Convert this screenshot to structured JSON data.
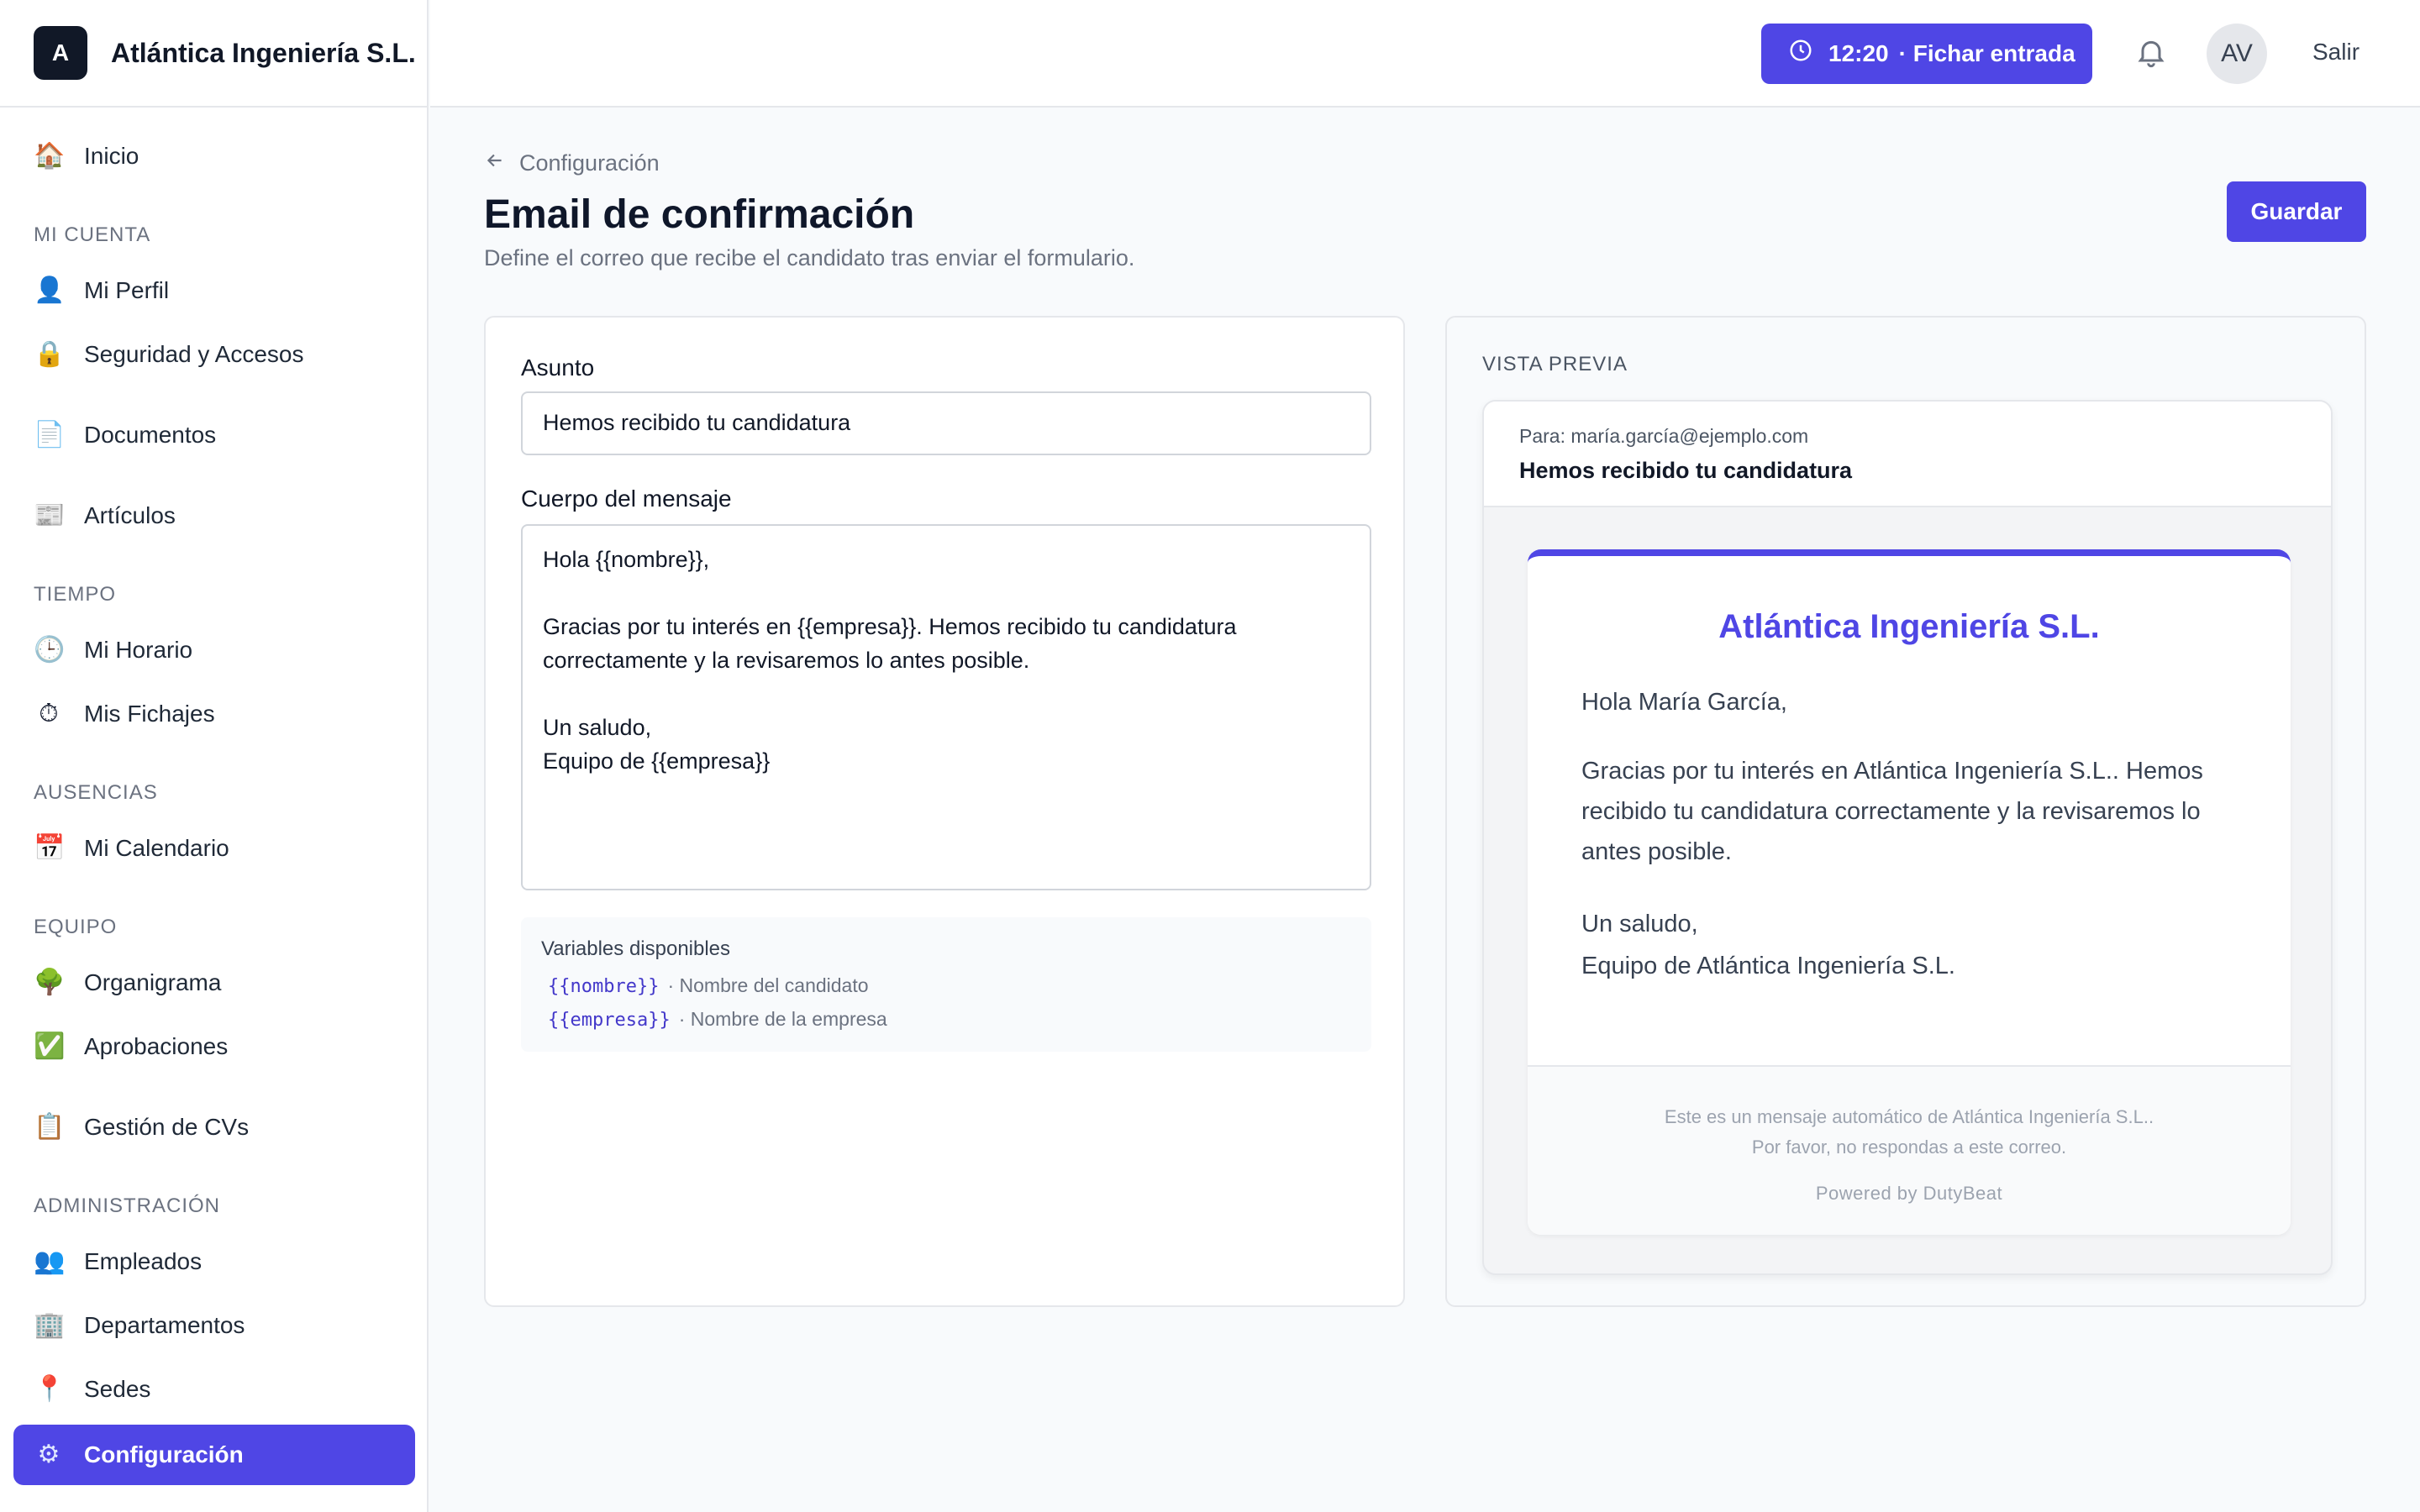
{
  "brand": {
    "logo_letter": "A",
    "name": "Atlántica Ingeniería S.L."
  },
  "header": {
    "clock_time": "12:20",
    "clock_action": "· Fichar entrada",
    "avatar_initials": "AV",
    "logout": "Salir"
  },
  "sidebar": {
    "sections": {
      "mi_cuenta": "MI CUENTA",
      "tiempo": "TIEMPO",
      "ausencias": "AUSENCIAS",
      "equipo": "EQUIPO",
      "administracion": "ADMINISTRACIÓN"
    },
    "items": [
      {
        "label": "Inicio",
        "icon": "🏠"
      },
      {
        "label": "Mi Perfil",
        "icon": "👤"
      },
      {
        "label": "Seguridad y Accesos",
        "icon": "🔒"
      },
      {
        "label": "Documentos",
        "icon": "📄"
      },
      {
        "label": "Artículos",
        "icon": "📰"
      },
      {
        "label": "Mi Horario",
        "icon": "🕒"
      },
      {
        "label": "Mis Fichajes",
        "icon": "⏱"
      },
      {
        "label": "Mi Calendario",
        "icon": "📅"
      },
      {
        "label": "Organigrama",
        "icon": "🌳"
      },
      {
        "label": "Aprobaciones",
        "icon": "✅"
      },
      {
        "label": "Gestión de CVs",
        "icon": "📋"
      },
      {
        "label": "Empleados",
        "icon": "👥"
      },
      {
        "label": "Departamentos",
        "icon": "🏢"
      },
      {
        "label": "Sedes",
        "icon": "📍"
      },
      {
        "label": "Configuración",
        "icon": "⚙"
      }
    ]
  },
  "page": {
    "back_label": "Configuración",
    "title": "Email de confirmación",
    "subtitle": "Define el correo que recibe el candidato tras enviar el formulario.",
    "save_label": "Guardar"
  },
  "editor": {
    "subject_label": "Asunto",
    "subject_value": "Hemos recibido tu candidatura",
    "body_label": "Cuerpo del mensaje",
    "body_value": "Hola {{nombre}},\n\nGracias por tu interés en {{empresa}}. Hemos recibido tu candidatura\ncorrectamente y la revisaremos lo antes posible.\n\nUn saludo,\nEquipo de {{empresa}}",
    "vars_title": "Variables disponibles",
    "vars": [
      {
        "code": "{{nombre}}",
        "desc": "· Nombre del candidato"
      },
      {
        "code": "{{empresa}}",
        "desc": "· Nombre de la empresa"
      }
    ]
  },
  "preview": {
    "label": "VISTA PREVIA",
    "to": "Para: maría.garcía@ejemplo.com",
    "subject": "Hemos recibido tu candidatura",
    "company": "Atlántica Ingeniería S.L.",
    "greeting": "Hola María García,",
    "paragraph": "Gracias por tu interés en Atlántica Ingeniería S.L.. Hemos recibido tu candidatura correctamente y la revisaremos lo antes posible.",
    "signoff_1": "Un saludo,",
    "signoff_2": "Equipo de Atlántica Ingeniería S.L.",
    "footer_1": "Este es un mensaje automático de Atlántica Ingeniería S.L..",
    "footer_2": "Por favor, no respondas a este correo.",
    "powered": "Powered by DutyBeat"
  },
  "colors": {
    "accent": "#4f46e5",
    "accent_text": "#4338ca",
    "muted": "#6b7280"
  }
}
